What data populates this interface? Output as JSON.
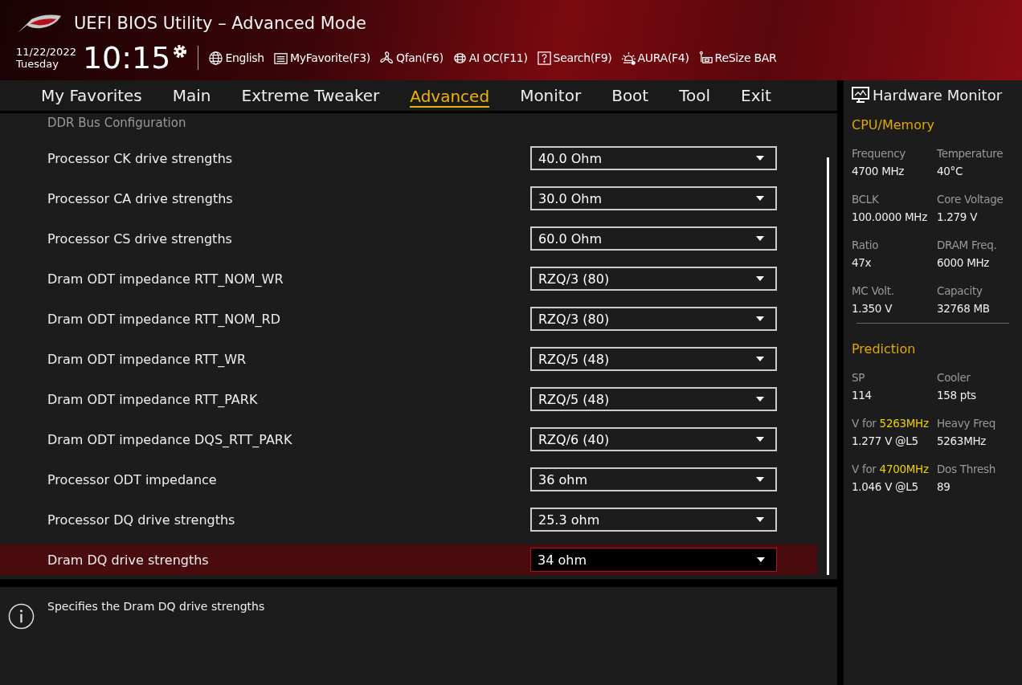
{
  "header": {
    "title": "UEFI BIOS Utility – Advanced Mode",
    "date": "11/22/2022",
    "day": "Tuesday",
    "time": "10:15",
    "tools": [
      {
        "kind": "globe",
        "label": "English"
      },
      {
        "kind": "list",
        "label": "MyFavorite(F3)"
      },
      {
        "kind": "fan",
        "label": "Qfan(F6)"
      },
      {
        "kind": "chip",
        "label": "AI OC(F11)"
      },
      {
        "kind": "help",
        "label": "Search(F9)"
      },
      {
        "kind": "light",
        "label": "AURA(F4)"
      },
      {
        "kind": "card",
        "label": "ReSize BAR"
      }
    ]
  },
  "tabs": [
    {
      "label": "My Favorites",
      "selected": false
    },
    {
      "label": "Main",
      "selected": false
    },
    {
      "label": "Extreme Tweaker",
      "selected": false
    },
    {
      "label": "Advanced",
      "selected": true
    },
    {
      "label": "Monitor",
      "selected": false
    },
    {
      "label": "Boot",
      "selected": false
    },
    {
      "label": "Tool",
      "selected": false
    },
    {
      "label": "Exit",
      "selected": false
    }
  ],
  "section_title": "DDR Bus Configuration",
  "settings": [
    {
      "label": "Processor CK drive strengths",
      "value": "40.0 Ohm",
      "selected": false
    },
    {
      "label": "Processor CA drive strengths",
      "value": "30.0 Ohm",
      "selected": false
    },
    {
      "label": "Processor CS drive strengths",
      "value": "60.0 Ohm",
      "selected": false
    },
    {
      "label": "Dram ODT impedance RTT_NOM_WR",
      "value": "RZQ/3 (80)",
      "selected": false
    },
    {
      "label": "Dram ODT impedance RTT_NOM_RD",
      "value": "RZQ/3 (80)",
      "selected": false
    },
    {
      "label": "Dram ODT impedance RTT_WR",
      "value": "RZQ/5 (48)",
      "selected": false
    },
    {
      "label": "Dram ODT impedance RTT_PARK",
      "value": "RZQ/5 (48)",
      "selected": false
    },
    {
      "label": "Dram ODT impedance DQS_RTT_PARK",
      "value": "RZQ/6 (40)",
      "selected": false
    },
    {
      "label": "Processor ODT impedance",
      "value": "36 ohm",
      "selected": false
    },
    {
      "label": "Processor DQ drive strengths",
      "value": "25.3 ohm",
      "selected": false
    },
    {
      "label": "Dram DQ drive strengths",
      "value": "34 ohm",
      "selected": true
    }
  ],
  "help_text": "Specifies the Dram DQ drive strengths",
  "hardware_monitor": {
    "title": "Hardware Monitor",
    "sections": [
      {
        "title": "CPU/Memory",
        "items": [
          {
            "label": "Frequency",
            "value": "4700 MHz"
          },
          {
            "label": "Temperature",
            "value": "40°C"
          },
          {
            "label": "BCLK",
            "value": "100.0000 MHz"
          },
          {
            "label": "Core Voltage",
            "value": "1.279 V"
          },
          {
            "label": "Ratio",
            "value": "47x"
          },
          {
            "label": "DRAM Freq.",
            "value": "6000 MHz"
          },
          {
            "label": "MC Volt.",
            "value": "1.350 V"
          },
          {
            "label": "Capacity",
            "value": "32768 MB"
          }
        ]
      },
      {
        "title": "Prediction",
        "items": [
          {
            "label": "SP",
            "value": "114"
          },
          {
            "label": "Cooler",
            "value": "158 pts"
          },
          {
            "label": "V for **5263MHz**",
            "value": "1.277 V @L5"
          },
          {
            "label": "Heavy Freq",
            "value": "5263MHz"
          },
          {
            "label": "V for **4700MHz**",
            "value": "1.046 V @L5"
          },
          {
            "label": "Dos Thresh",
            "value": "89"
          }
        ]
      }
    ]
  }
}
